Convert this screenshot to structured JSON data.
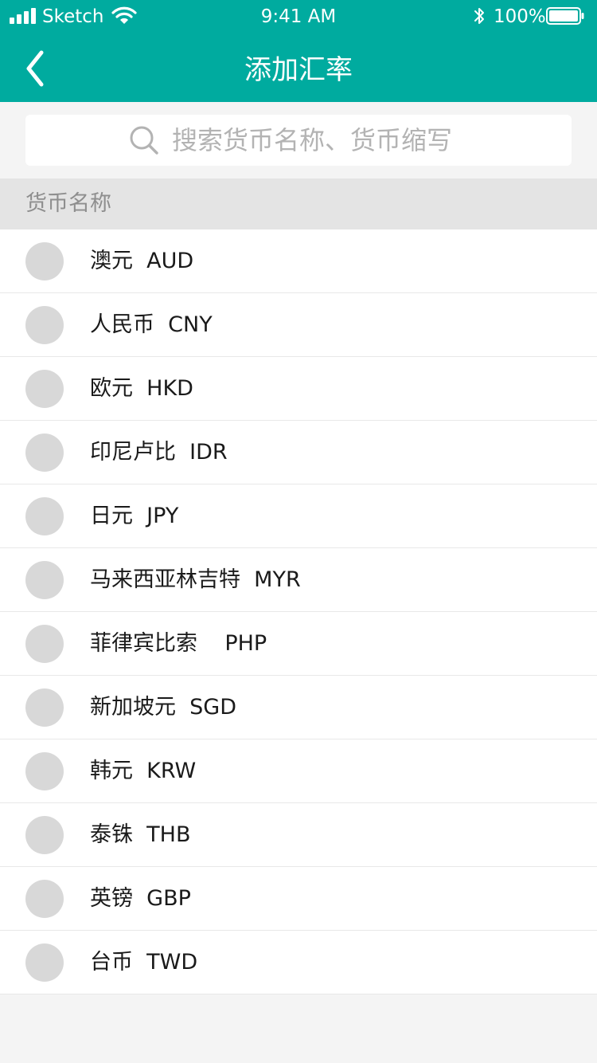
{
  "status_bar": {
    "carrier": "Sketch",
    "time": "9:41 AM",
    "battery": "100%"
  },
  "nav": {
    "title": "添加汇率",
    "back_icon": "chevron-left-icon"
  },
  "search": {
    "placeholder": "搜索货币名称、货币缩写",
    "value": "",
    "icon": "search-icon"
  },
  "section": {
    "title": "货币名称"
  },
  "currencies": [
    {
      "name": "澳元",
      "code": "AUD",
      "label": "澳元  AUD"
    },
    {
      "name": "人民币",
      "code": "CNY",
      "label": "人民币  CNY"
    },
    {
      "name": "欧元",
      "code": "HKD",
      "label": "欧元  HKD"
    },
    {
      "name": "印尼卢比",
      "code": "IDR",
      "label": "印尼卢比  IDR"
    },
    {
      "name": "日元",
      "code": "JPY",
      "label": "日元  JPY"
    },
    {
      "name": "马来西亚林吉特",
      "code": "MYR",
      "label": "马来西亚林吉特  MYR"
    },
    {
      "name": "菲律宾比索",
      "code": "PHP",
      "label": "菲律宾比索    PHP"
    },
    {
      "name": "新加坡元",
      "code": "SGD",
      "label": "新加坡元  SGD"
    },
    {
      "name": "韩元",
      "code": "KRW",
      "label": "韩元  KRW"
    },
    {
      "name": "泰铢",
      "code": "THB",
      "label": "泰铢  THB"
    },
    {
      "name": "英镑",
      "code": "GBP",
      "label": "英镑  GBP"
    },
    {
      "name": "台币",
      "code": "TWD",
      "label": "台币  TWD"
    }
  ],
  "colors": {
    "brand": "#00ab9f",
    "placeholder": "#b3b3b3",
    "section_bg": "#e4e4e4",
    "flag_placeholder": "#d8d8d8"
  }
}
